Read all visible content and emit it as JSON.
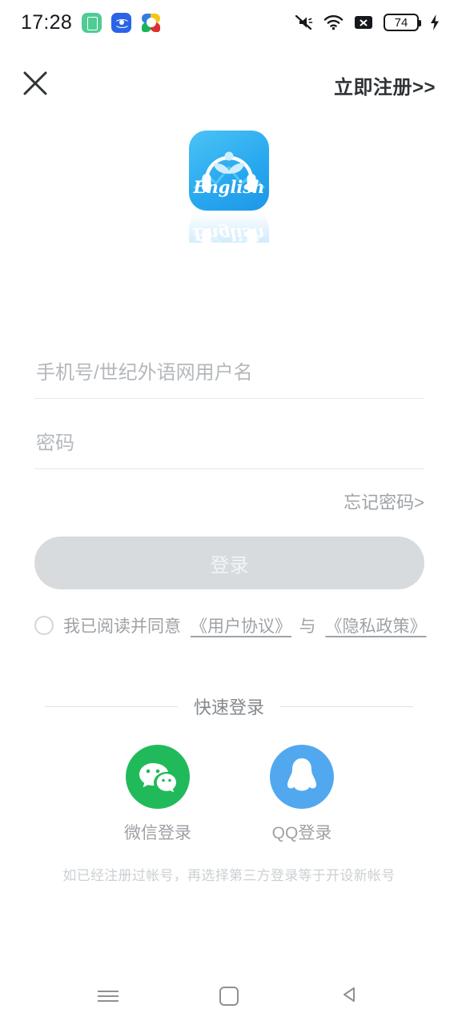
{
  "status_bar": {
    "time": "17:28",
    "app_icons": [
      "checklist-app-icon",
      "broadcast-app-icon",
      "colorful-app-icon"
    ],
    "right_icons": [
      "mute-icon",
      "wifi-icon",
      "no-sim-icon",
      "battery-icon",
      "charging-bolt-icon"
    ],
    "battery_level": "74"
  },
  "top_nav": {
    "close_icon": "close-icon",
    "register_label": "立即注册>>"
  },
  "logo": {
    "brand_text": "English",
    "icon": "english-headphone-app-logo",
    "color": "#29a9ef"
  },
  "form": {
    "account_placeholder": "手机号/世纪外语网用户名",
    "account_value": "",
    "password_placeholder": "密码",
    "password_value": "",
    "forgot_label": "忘记密码>",
    "login_label": "登录",
    "login_enabled": false,
    "agree_checked": false,
    "agree_prefix": "我已阅读并同意",
    "agree_user_terms": "《用户协议》",
    "agree_conjunction": "与",
    "agree_privacy": "《隐私政策》"
  },
  "quick_login": {
    "divider_label": "快速登录",
    "methods": [
      {
        "label": "微信登录",
        "icon": "wechat-icon",
        "color": "#21ba5a"
      },
      {
        "label": "QQ登录",
        "icon": "qq-icon",
        "color": "#52a8ee"
      }
    ],
    "footer_note": "如已经注册过帐号，再选择第三方登录等于开设新帐号"
  },
  "nav_bar": {
    "recents": "recents-icon",
    "home": "home-icon",
    "back": "back-icon"
  }
}
